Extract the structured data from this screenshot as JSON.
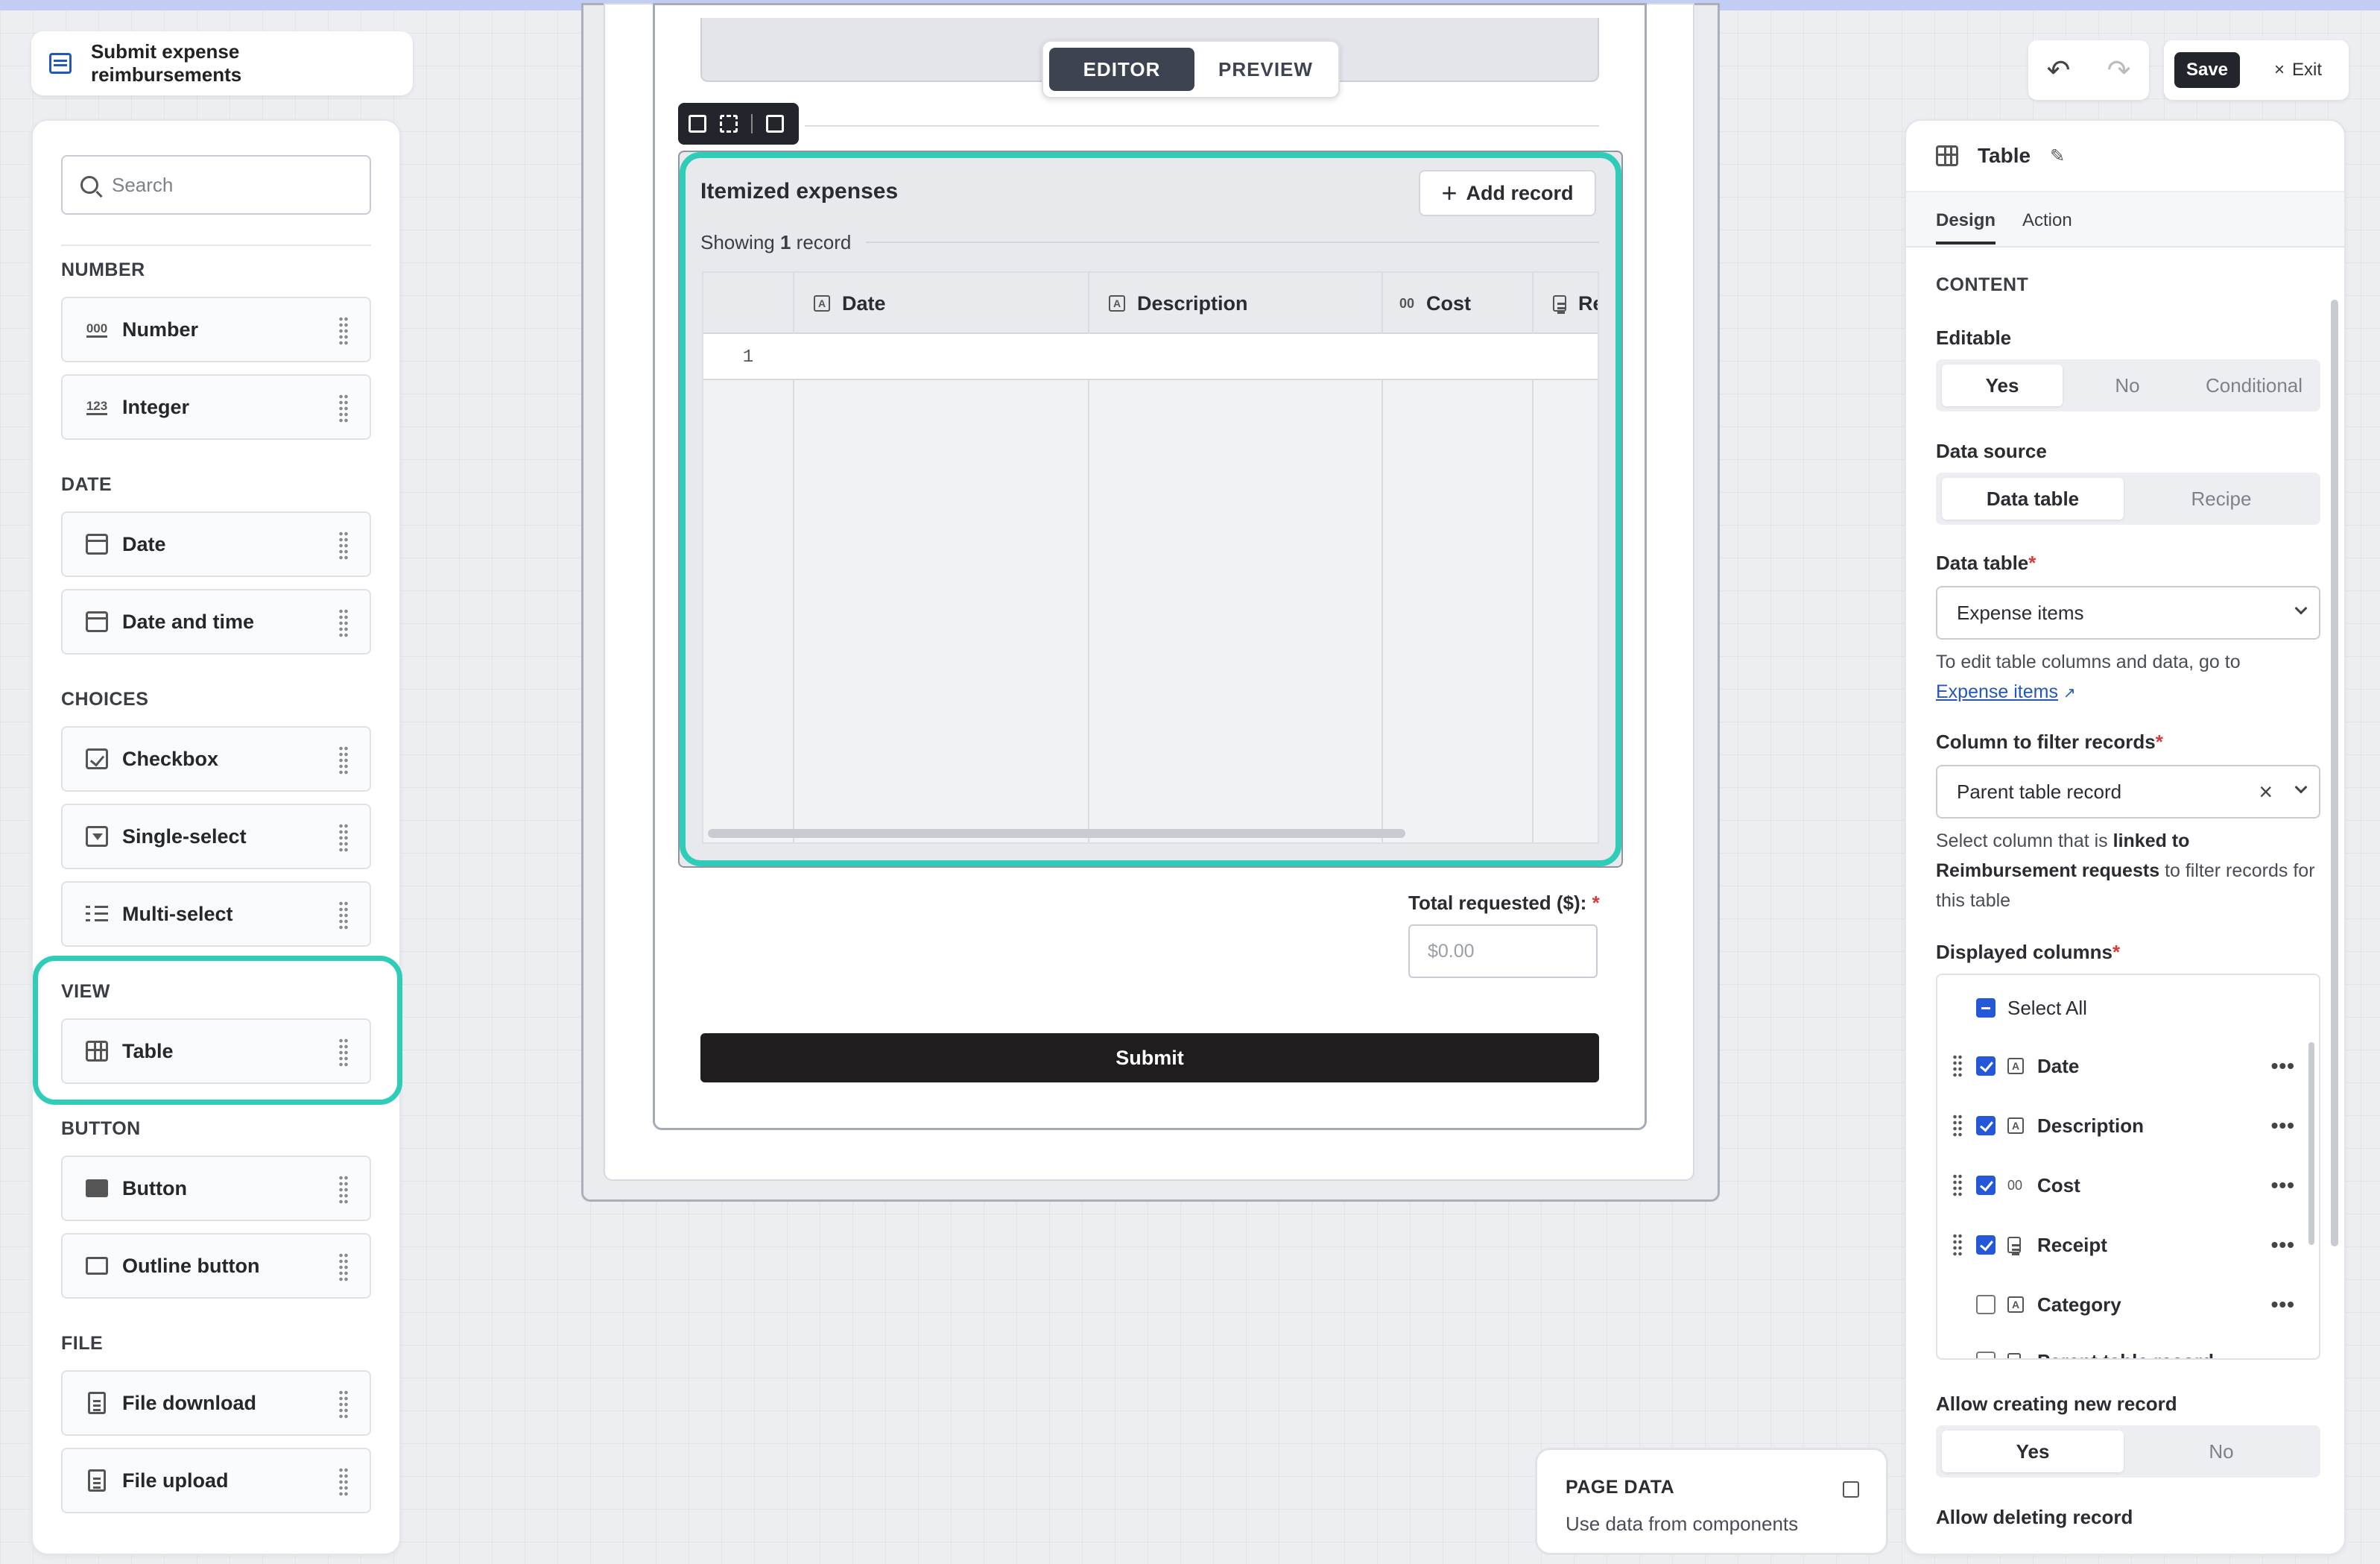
{
  "app": {
    "title": "Submit expense reimbursements"
  },
  "mode_toggle": {
    "editor": "EDITOR",
    "preview": "PREVIEW"
  },
  "toolbar": {
    "save": "Save",
    "exit": "Exit",
    "undo_icon": "undo-icon",
    "redo_icon": "redo-icon"
  },
  "sidebar": {
    "search_placeholder": "Search",
    "sections": {
      "number": "NUMBER",
      "date": "DATE",
      "choices": "CHOICES",
      "view": "VIEW",
      "button": "BUTTON",
      "file": "FILE"
    },
    "items": {
      "number": "Number",
      "integer": "Integer",
      "date": "Date",
      "date_time": "Date and time",
      "checkbox": "Checkbox",
      "single_select": "Single-select",
      "multi_select": "Multi-select",
      "table": "Table",
      "button": "Button",
      "outline_button": "Outline button",
      "file_download": "File download",
      "file_upload": "File upload"
    },
    "icon_labels": {
      "number": "000",
      "integer": "123"
    }
  },
  "table_view": {
    "title": "Itemized expenses",
    "add_record": "Add record",
    "showing_prefix": "Showing",
    "showing_count": "1",
    "showing_suffix": "record",
    "columns": [
      "Date",
      "Description",
      "Cost",
      "Re"
    ],
    "column_icons": [
      "A",
      "A",
      "00",
      "file"
    ],
    "row_numbers": [
      "1"
    ]
  },
  "form": {
    "total_label": "Total requested ($):",
    "required_mark": "*",
    "total_placeholder": "$0.00",
    "submit": "Submit"
  },
  "page_data_box": {
    "title": "PAGE DATA",
    "subtitle": "Use data from components"
  },
  "right_panel": {
    "component_name": "Table",
    "tabs": [
      "Design",
      "Action"
    ],
    "content_heading": "CONTENT",
    "editable": {
      "label": "Editable",
      "options": [
        "Yes",
        "No",
        "Conditional"
      ],
      "selected": "Yes"
    },
    "data_source": {
      "label": "Data source",
      "options": [
        "Data table",
        "Recipe"
      ],
      "selected": "Data table"
    },
    "data_table": {
      "label": "Data table",
      "value": "Expense items"
    },
    "edit_hint": {
      "prefix": "To edit table columns and data, go to",
      "link": "Expense items"
    },
    "filter_column": {
      "label": "Column to filter records",
      "value": "Parent table record"
    },
    "filter_hint": {
      "part1": "Select column that is",
      "bold1": "linked to Reimbursement requests",
      "part2": "to filter records for this table"
    },
    "displayed_columns": {
      "label": "Displayed columns",
      "select_all": "Select All",
      "items": [
        {
          "name": "Date",
          "checked": true,
          "icon": "A"
        },
        {
          "name": "Description",
          "checked": true,
          "icon": "A"
        },
        {
          "name": "Cost",
          "checked": true,
          "icon": "00"
        },
        {
          "name": "Receipt",
          "checked": true,
          "icon": "file"
        },
        {
          "name": "Category",
          "checked": false,
          "icon": "A"
        },
        {
          "name": "Parent table record",
          "checked": false,
          "icon": "file"
        }
      ]
    },
    "allow_new": {
      "label": "Allow creating new record",
      "options": [
        "Yes",
        "No"
      ],
      "selected": "Yes"
    },
    "allow_delete": {
      "label": "Allow deleting record"
    }
  },
  "colors": {
    "accent_highlight": "#2fcdb8",
    "link": "#2458b8",
    "checkbox": "#2458d8",
    "required": "#d93a3a"
  }
}
